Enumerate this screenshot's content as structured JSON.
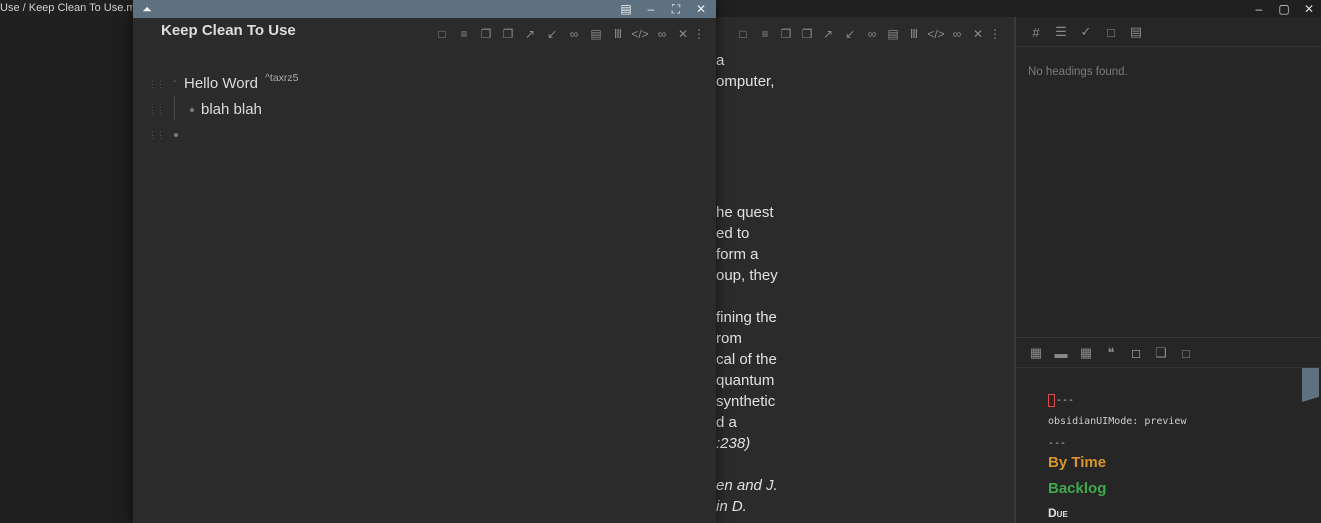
{
  "window": {
    "title": "Use / Keep Clean To Use.md"
  },
  "main_editor": {
    "lines": [
      "a",
      "omputer,",
      "he quest",
      "ed to",
      "form a",
      "oup, they",
      "fining the",
      "rom",
      "cal of the",
      "quantum",
      "synthetic",
      "d a",
      ":238)",
      "en and J.",
      "in D."
    ]
  },
  "sidebar": {
    "no_headings": "No headings found.",
    "frontmatter_open": "---",
    "frontmatter_line": "obsidianUIMode: preview",
    "frontmatter_close": "---",
    "headings": [
      {
        "label": "By Time",
        "color": "#d9952a"
      },
      {
        "label": "Backlog",
        "color": "#3fa84a"
      },
      {
        "label": "Due",
        "color": "#e0e0e0"
      }
    ]
  },
  "popover": {
    "title": "Keep Clean To Use",
    "items": [
      {
        "text": "Hello Word",
        "ref": "^taxrz5"
      },
      {
        "text": "blah blah"
      },
      {
        "text": ""
      }
    ]
  },
  "colors": {
    "accent": "#5d7180",
    "background": "#2b2b2b",
    "cursor": "#e04a4a"
  }
}
